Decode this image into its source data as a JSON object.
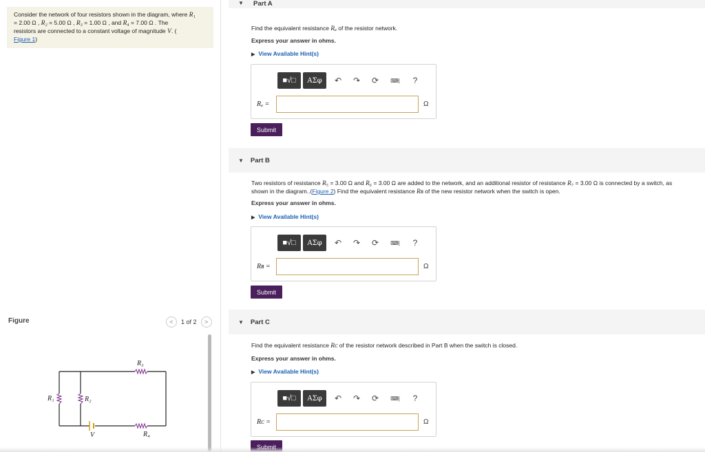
{
  "problem": {
    "line1_pre": "Consider the network of four resistors shown in the diagram, where ",
    "r1_sym": "R₁",
    "line2": "= 2.00 Ω , ",
    "r2_sym": "R₂",
    "r2_val": " = 5.00 Ω , ",
    "r3_sym": "R₃",
    "r3_val": " = 1.00 Ω , and ",
    "r4_sym": "R₄",
    "r4_val": " = 7.00 Ω . The",
    "line3_pre": "resistors are connected to a constant voltage of magnitude ",
    "v_sym": "V",
    "line3_post": ". (",
    "figure_link": "Figure 1",
    "close_paren": ")"
  },
  "figure": {
    "title": "Figure",
    "pager": {
      "prev": "<",
      "count": "1 of 2",
      "next": ">"
    },
    "labels": {
      "r1": "R₁",
      "r2": "R₂",
      "r3": "R₃",
      "r4": "R₄",
      "v": "V"
    }
  },
  "parts": {
    "a": {
      "header": "Part A",
      "question_pre": "Find the equivalent resistance ",
      "question_sym": "Rₐ",
      "question_post": " of the resistor network.",
      "express": "Express your answer in ohms.",
      "hint": "View Available Hint(s)",
      "var": "Rₐ =",
      "unit": "Ω",
      "submit": "Submit"
    },
    "b": {
      "header": "Part B",
      "q1": "Two resistors of resistance ",
      "r5": "R₅",
      "q2": " = 3.00 Ω and ",
      "r6": "R₆",
      "q3": " = 3.00 Ω are added to the network, and an additional resistor of resistance ",
      "r7": "R₇",
      "q4": " = 3.00 Ω is connected by a switch, as",
      "q5": "shown in the diagram..(",
      "fig_link": "Figure 2",
      "q6": ") Find the equivalent resistance ",
      "rb": "Rʙ",
      "q7": " of the new resistor network when the switch is open.",
      "express": "Express your answer in ohms.",
      "hint": "View Available Hint(s)",
      "var": "Rʙ =",
      "unit": "Ω",
      "submit": "Submit"
    },
    "c": {
      "header": "Part C",
      "question_pre": "Find the equivalent resistance ",
      "question_sym": "Rᴄ",
      "question_post": " of the resistor network described in Part B when the switch is closed.",
      "express": "Express your answer in ohms.",
      "hint": "View Available Hint(s)",
      "var": "Rᴄ =",
      "unit": "Ω",
      "submit": "Submit"
    }
  },
  "toolbar": {
    "templates": "■√□",
    "greek": "AΣφ",
    "undo": "↶",
    "redo": "↷",
    "reset": "⟳",
    "keyboard": "⌨|",
    "help": "?"
  },
  "colors": {
    "submit_bg": "#4a1f5c",
    "link": "#1a5fb4",
    "problem_bg": "#f5f3e6",
    "input_border": "#c8a35a"
  }
}
